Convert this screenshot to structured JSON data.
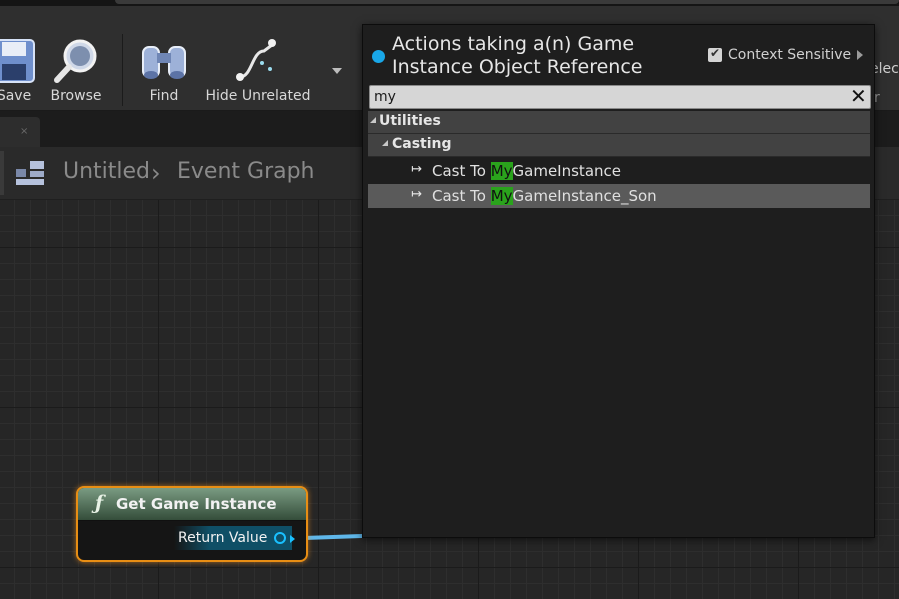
{
  "toolbar": {
    "save_label": "Save",
    "browse_label": "Browse",
    "find_label": "Find",
    "hide_unrelated_label": "Hide Unrelated",
    "clipped_right_top": "elect",
    "clipped_right_bottom": "r"
  },
  "tabs": {
    "close_glyph": "×"
  },
  "breadcrumb": {
    "root": "Untitled",
    "separator": "›",
    "current": "Event Graph"
  },
  "node": {
    "icon": "function-icon",
    "fx_glyph": "ƒ",
    "title": "Get Game Instance",
    "output_label": "Return Value",
    "accent_color": "#e88e14",
    "pin_color": "#19c0ff"
  },
  "popup": {
    "title": "Actions taking a(n) Game Instance Object Reference",
    "context_sensitive_label": "Context Sensitive",
    "context_sensitive_checked": true,
    "search_value": "my",
    "clear_glyph": "✕",
    "categories": [
      {
        "label": "Utilities"
      },
      {
        "label": "Casting"
      }
    ],
    "items": [
      {
        "prefix": "Cast To ",
        "match": "My",
        "suffix": "GameInstance",
        "selected": false
      },
      {
        "prefix": "Cast To ",
        "match": "My",
        "suffix": "GameInstance_Son",
        "selected": true
      }
    ],
    "item_icon_glyph": "↦",
    "highlight_color": "#2aa31c"
  }
}
